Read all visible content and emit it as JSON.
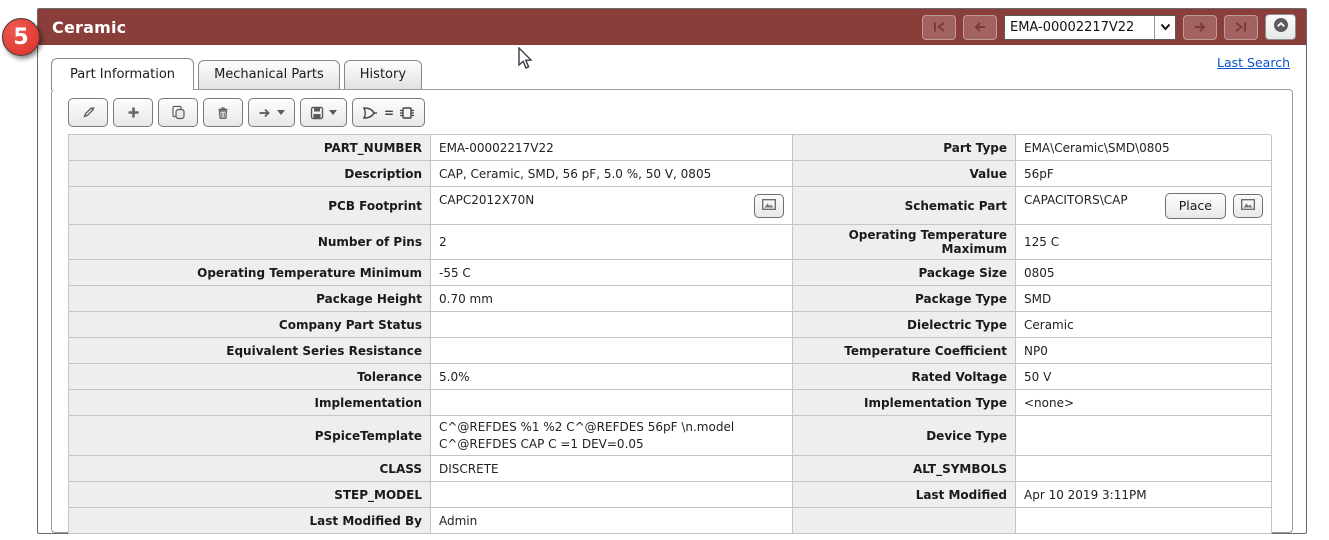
{
  "badge": {
    "number": "5"
  },
  "header": {
    "title": "Ceramic",
    "nav": {
      "selected_part": "EMA-00002217V22",
      "buttons": [
        "first",
        "previous",
        "next",
        "last",
        "collapse"
      ]
    }
  },
  "links": {
    "last_search": "Last Search"
  },
  "tabs": [
    {
      "label": "Part Information",
      "active": true
    },
    {
      "label": "Mechanical Parts",
      "active": false
    },
    {
      "label": "History",
      "active": false
    }
  ],
  "toolbar": {
    "buttons": [
      "edit",
      "add",
      "copy",
      "delete",
      "transfer",
      "save",
      "symbol-footprint-check"
    ]
  },
  "buttons": {
    "place": "Place"
  },
  "table": {
    "rows": [
      {
        "l1": "PART_NUMBER",
        "v1": "EMA-00002217V22",
        "l2": "Part Type",
        "v2": "EMA\\Ceramic\\SMD\\0805"
      },
      {
        "l1": "Description",
        "v1": "CAP, Ceramic, SMD, 56 pF, 5.0 %, 50 V, 0805",
        "l2": "Value",
        "v2": "56pF"
      },
      {
        "l1": "PCB Footprint",
        "v1": "CAPC2012X70N",
        "l2": "Schematic Part",
        "v2": "CAPACITORS\\CAP"
      },
      {
        "l1": "Number of Pins",
        "v1": "2",
        "l2": "Operating Temperature Maximum",
        "v2": "125 C"
      },
      {
        "l1": "Operating Temperature Minimum",
        "v1": "-55 C",
        "l2": "Package Size",
        "v2": "0805"
      },
      {
        "l1": "Package Height",
        "v1": "0.70 mm",
        "l2": "Package Type",
        "v2": "SMD"
      },
      {
        "l1": "Company Part Status",
        "v1": "",
        "l2": "Dielectric Type",
        "v2": "Ceramic"
      },
      {
        "l1": "Equivalent Series Resistance",
        "v1": "",
        "l2": "Temperature Coefficient",
        "v2": "NP0"
      },
      {
        "l1": "Tolerance",
        "v1": "5.0%",
        "l2": "Rated Voltage",
        "v2": "50 V"
      },
      {
        "l1": "Implementation",
        "v1": "",
        "l2": "Implementation Type",
        "v2": "<none>"
      },
      {
        "l1": "PSpiceTemplate",
        "v1": "C^@REFDES %1 %2 C^@REFDES 56pF \\n.model C^@REFDES CAP C =1 DEV=0.05",
        "l2": "Device Type",
        "v2": ""
      },
      {
        "l1": "CLASS",
        "v1": "DISCRETE",
        "l2": "ALT_SYMBOLS",
        "v2": ""
      },
      {
        "l1": "STEP_MODEL",
        "v1": "",
        "l2": "Last Modified",
        "v2": "Apr 10 2019 3:11PM"
      },
      {
        "l1": "Last Modified By",
        "v1": "Admin",
        "l2": "",
        "v2": ""
      }
    ]
  },
  "colors": {
    "header_bg": "#8a3e3a",
    "badge_red": "#da2f28",
    "link_blue": "#0f52c9",
    "label_bg": "#eeeeee",
    "grid_line": "#c4c4c4"
  }
}
